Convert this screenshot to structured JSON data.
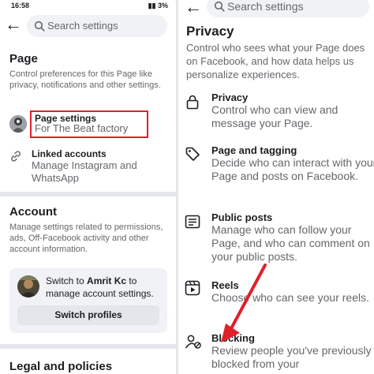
{
  "left": {
    "status": {
      "time": "16:58",
      "battery": "3%"
    },
    "search": {
      "placeholder": "Search settings"
    },
    "page_section": {
      "title": "Page",
      "description": "Control preferences for this Page like privacy, notifications and other settings.",
      "items": [
        {
          "title": "Page settings",
          "subtitle": "For The Beat factory",
          "icon": "avatar-icon"
        },
        {
          "title": "Linked accounts",
          "subtitle": "Manage Instagram and WhatsApp",
          "icon": "link-icon"
        }
      ]
    },
    "account_section": {
      "title": "Account",
      "description": "Manage settings related to permissions, ads, Off-Facebook activity and other account information.",
      "card_text_prefix": "Switch to ",
      "card_name": "Amrit Kc",
      "card_text_suffix": " to manage account settings.",
      "switch_button": "Switch profiles"
    },
    "legal_section": {
      "title": "Legal and policies"
    }
  },
  "right": {
    "search": {
      "placeholder": "Search settings"
    },
    "privacy": {
      "title": "Privacy",
      "description": "Control who sees what your Page does on Facebook, and how data helps us personalize experiences.",
      "items": [
        {
          "title": "Privacy",
          "subtitle": "Control who can view and message your Page.",
          "icon": "lock-icon"
        },
        {
          "title": "Page and tagging",
          "subtitle": "Decide who can interact with your Page and posts on Facebook.",
          "icon": "tag-icon"
        },
        {
          "title": "Public posts",
          "subtitle": "Manage who can follow your Page, and who can comment on your public posts.",
          "icon": "public-posts-icon"
        },
        {
          "title": "Reels",
          "subtitle": "Choose who can see your reels.",
          "icon": "reels-icon"
        },
        {
          "title": "Blocking",
          "subtitle": "Review people you've previously blocked from your",
          "icon": "blocking-icon"
        }
      ]
    }
  },
  "colors": {
    "highlight": "#e0202a",
    "text": "#1c1e21",
    "muted": "#65676b",
    "search_bg": "#f0f2f5"
  }
}
